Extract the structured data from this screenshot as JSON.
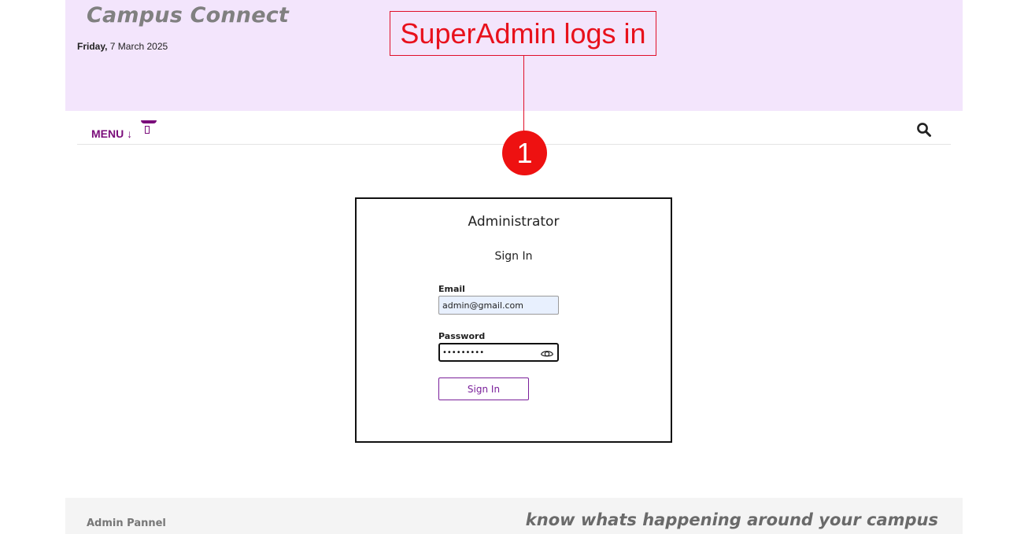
{
  "header": {
    "site_title": "Campus Connect",
    "date_weekday": "Friday,",
    "date_rest": " 7 March 2025"
  },
  "annotation": {
    "caption": "SuperAdmin logs in",
    "step_number": "1",
    "color": "#e8111c"
  },
  "nav": {
    "menu_label": "MENU ↓",
    "menu_extra_icon": "menu-bookmark-icon",
    "search_icon": "search-icon",
    "accent_color": "#7a0c7a"
  },
  "login": {
    "title": "Administrator",
    "subtitle": "Sign In",
    "email_label": "Email",
    "email_value": "admin@gmail.com",
    "password_label": "Password",
    "password_value": "•••••••••",
    "password_toggle_icon": "eye-icon",
    "submit_label": "Sign In"
  },
  "footer": {
    "left_text": "Admin Pannel",
    "tagline": "know whats happening around your campus"
  },
  "colors": {
    "header_bg": "#f3e5fc",
    "button_accent": "#7a1f9a"
  }
}
